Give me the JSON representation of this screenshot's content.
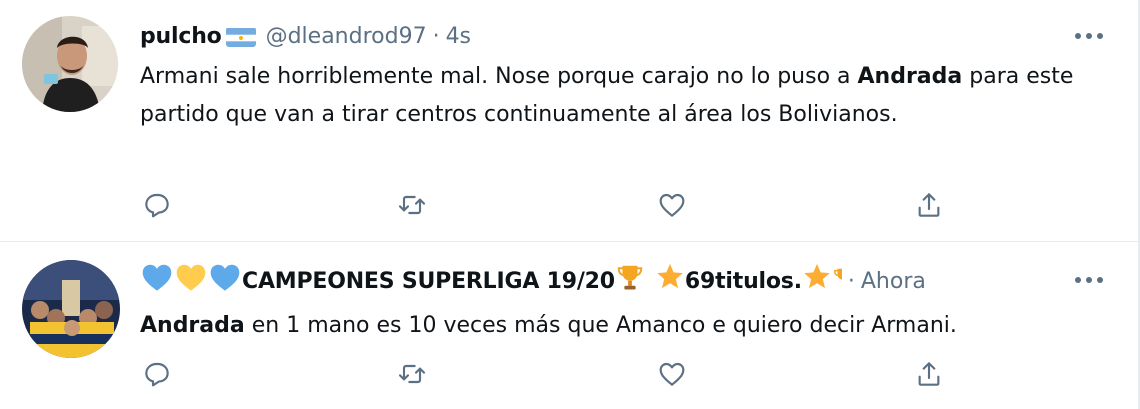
{
  "tweets": [
    {
      "display_name": "pulcho",
      "handle": "@dleandrod97",
      "separator": "·",
      "time": "4s",
      "text_before": "Armani sale horriblemente mal. Nose porque carajo no lo puso a ",
      "text_bold": "Andrada",
      "text_after": " para este partido que van a tirar centros continuamente al área los Bolivianos."
    },
    {
      "display_name": "CAMPEONES SUPERLIGA 19/20",
      "display_name_suffix": "69titulos.",
      "separator": "·",
      "time": "Ahora",
      "text_bold": "Andrada",
      "text_after": " en 1 mano es 10 veces más que Amanco e quiero decir Armani."
    }
  ],
  "icons": {
    "reply": "reply-icon",
    "retweet": "retweet-icon",
    "like": "heart-icon",
    "share": "share-icon",
    "more": "more-icon"
  },
  "colors": {
    "secondary_text": "#5b7083",
    "divider": "#e6ecf0",
    "flag_blue": "#74acdf",
    "heart_blue": "#5da9e9",
    "heart_yellow": "#ffcc4d",
    "trophy": "#f4a623"
  }
}
